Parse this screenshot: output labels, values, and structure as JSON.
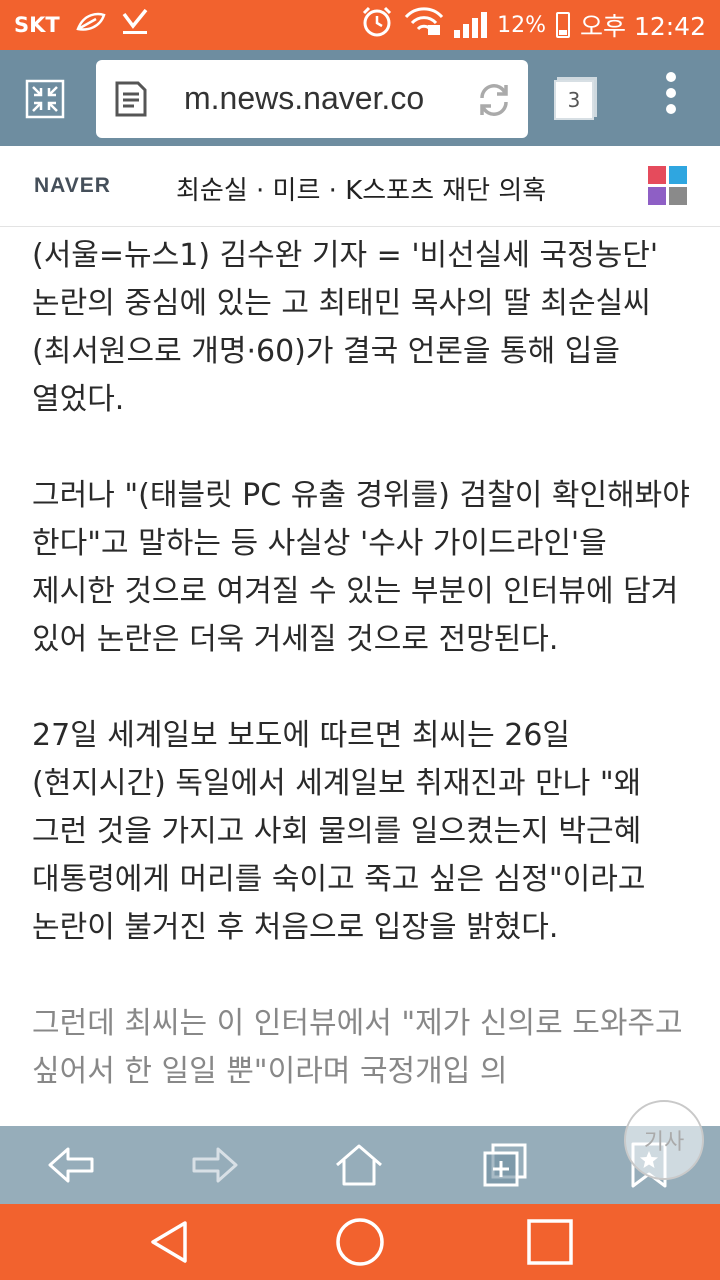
{
  "status_bar": {
    "carrier": "SKT",
    "battery": "12%",
    "time": "오후 12:42"
  },
  "browser": {
    "url": "m.news.naver.co",
    "tab_count": "3"
  },
  "naver_header": {
    "logo": "NAVER",
    "topic": "최순실 · 미르 · K스포츠 재단 의혹"
  },
  "article": {
    "paragraphs": [
      "(서울=뉴스1) 김수완 기자 = '비선실세 국정농단' 논란의 중심에 있는 고 최태민 목사의 딸 최순실씨(최서원으로 개명·60)가 결국 언론을 통해 입을 열었다.",
      "그러나 \"(태블릿 PC 유출 경위를) 검찰이 확인해봐야 한다\"고 말하는 등 사실상 '수사 가이드라인'을 제시한 것으로 여겨질 수 있는 부분이 인터뷰에 담겨 있어 논란은 더욱 거세질 것으로 전망된다.",
      "27일 세계일보 보도에 따르면 최씨는 26일(현지시간) 독일에서 세계일보 취재진과 만나 \"왜 그런 것을 가지고 사회 물의를 일으켰는지 박근혜 대통령에게 머리를 숙이고 죽고 싶은 심정\"이라고 논란이 불거진 후 처음으로 입장을 밝혔다.",
      "그런데 최씨는 이 인터뷰에서 \"제가 신의로 도와주고 싶어서 한 일일 뿐\"이라며 국정개입 의"
    ]
  },
  "fab": {
    "label": "기사"
  },
  "colors": {
    "status_bar": "#f2622e",
    "toolbar": "#6e8da0",
    "nav_bar": "#f2622e"
  }
}
